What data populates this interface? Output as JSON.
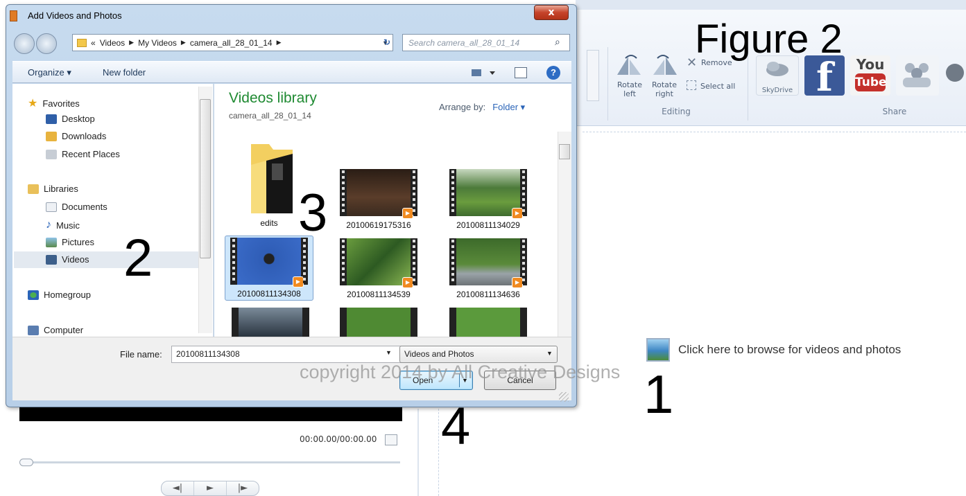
{
  "figure_label": "Figure 2",
  "annotations": {
    "n1": "1",
    "n2": "2",
    "n3": "3",
    "n4": "4"
  },
  "watermark": "copyright 2014 by All Creative Designs",
  "ribbon": {
    "rotate_left": "Rotate left",
    "rotate_right": "Rotate right",
    "remove": "Remove",
    "select_all": "Select all",
    "editing_group": "Editing",
    "share_group": "Share",
    "skydrive": "SkyDrive",
    "facebook": "f",
    "youtube_top": "You",
    "youtube_bottom": "Tube"
  },
  "player": {
    "timecode": "00:00.00/00:00.00",
    "progress": 0,
    "controls": [
      "◄|",
      "►",
      "|►"
    ]
  },
  "browse_prompt": "Click here to browse for videos and photos",
  "dialog": {
    "title": "Add Videos and Photos",
    "close": "x",
    "breadcrumb": [
      "«",
      "Videos",
      "My Videos",
      "camera_all_28_01_14"
    ],
    "search_placeholder": "Search camera_all_28_01_14",
    "toolbar": {
      "organize": "Organize ▾",
      "new_folder": "New folder",
      "help": "?"
    },
    "nav": {
      "favorites": "Favorites",
      "desktop": "Desktop",
      "downloads": "Downloads",
      "recent_places": "Recent Places",
      "libraries": "Libraries",
      "documents": "Documents",
      "music": "Music",
      "pictures": "Pictures",
      "videos": "Videos",
      "homegroup": "Homegroup",
      "computer": "Computer"
    },
    "library": {
      "title": "Videos library",
      "subtitle": "camera_all_28_01_14",
      "arrange_label": "Arrange by:",
      "arrange_value": "Folder ▾"
    },
    "items": [
      "edits",
      "20100619175316",
      "20100811134029",
      "20100811134308",
      "20100811134539",
      "20100811134636"
    ],
    "file_name_label": "File name:",
    "file_name_value": "20100811134308",
    "file_type": "Videos and Photos",
    "open": "Open",
    "cancel": "Cancel"
  },
  "colors": {
    "library_title": "#1f8a32",
    "selection": "#cde6fb",
    "facebook": "#3b5998",
    "play_badge": "#f08a20"
  }
}
